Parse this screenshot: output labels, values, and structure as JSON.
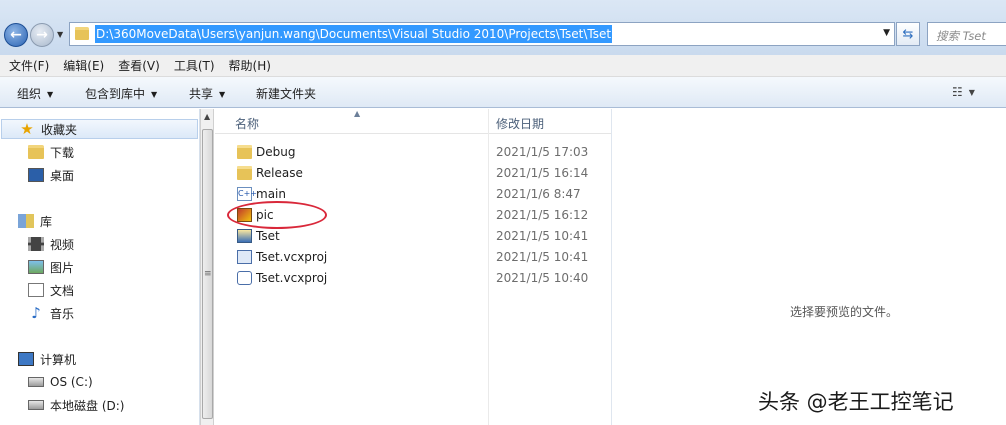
{
  "address_bar": {
    "path": "D:\\360MoveData\\Users\\yanjun.wang\\Documents\\Visual Studio 2010\\Projects\\Tset\\Tset",
    "search_placeholder": "搜索 Tset"
  },
  "menu": [
    "文件(F)",
    "编辑(E)",
    "查看(V)",
    "工具(T)",
    "帮助(H)"
  ],
  "toolbar": {
    "organize": "组织",
    "include_in_library": "包含到库中",
    "share": "共享",
    "new_folder": "新建文件夹"
  },
  "nav_pane": {
    "favorites": "收藏夹",
    "downloads": "下载",
    "desktop": "桌面",
    "libraries": "库",
    "videos": "视频",
    "pictures": "图片",
    "documents": "文档",
    "music": "音乐",
    "computer": "计算机",
    "drive_c": "OS (C:)",
    "drive_d": "本地磁盘 (D:)"
  },
  "columns": {
    "name": "名称",
    "date": "修改日期"
  },
  "files": [
    {
      "name": "Debug",
      "date": "2021/1/5 17:03",
      "icon": "folder-icon"
    },
    {
      "name": "Release",
      "date": "2021/1/5 16:14",
      "icon": "folder-icon"
    },
    {
      "name": "main",
      "date": "2021/1/6 8:47",
      "icon": "cpp-file-icon"
    },
    {
      "name": "pic",
      "date": "2021/1/5 16:12",
      "icon": "image-file-icon"
    },
    {
      "name": "Tset",
      "date": "2021/1/5 10:41",
      "icon": "exe-file-icon"
    },
    {
      "name": "Tset.vcxproj",
      "date": "2021/1/5 10:41",
      "icon": "vcxproj-file-icon"
    },
    {
      "name": "Tset.vcxproj",
      "date": "2021/1/5 10:40",
      "icon": "vcxproj-filters-icon"
    }
  ],
  "preview": {
    "message": "选择要预览的文件。"
  },
  "watermark": "头条 @老王工控笔记",
  "colors": {
    "selection": "#3399ff",
    "annotation": "#d9283a"
  }
}
